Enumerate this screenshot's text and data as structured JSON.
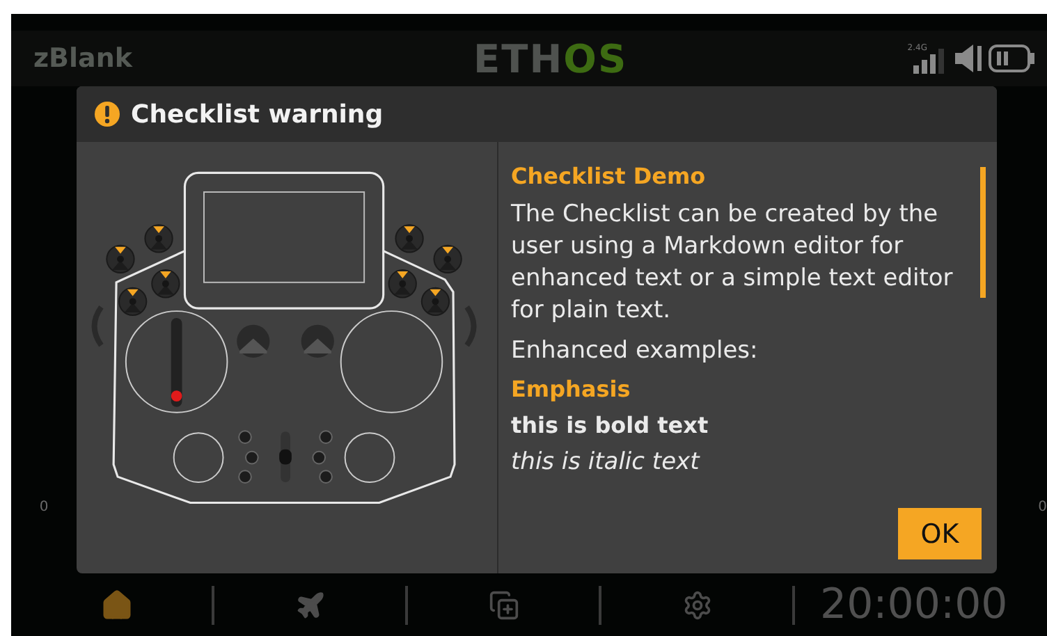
{
  "topbar": {
    "model_name": "zBlank",
    "logo": {
      "part_1": "ETH",
      "part_2": "OS"
    },
    "radio_band": "2.4G"
  },
  "background_readings": [
    "0",
    "0"
  ],
  "dialog": {
    "title": "Checklist warning",
    "content": [
      {
        "kind": "heading",
        "text": "Checklist Demo"
      },
      {
        "kind": "paragraph",
        "text": "The Checklist can be created by the user using a Markdown editor for enhanced text or a simple text editor for plain text."
      },
      {
        "kind": "paragraph",
        "text": "Enhanced examples:"
      },
      {
        "kind": "heading",
        "text": "Emphasis"
      },
      {
        "kind": "bold",
        "text": "this is bold text"
      },
      {
        "kind": "italic",
        "text": "this is italic text"
      }
    ],
    "button": "OK"
  },
  "navbar": {
    "items": [
      {
        "kind": "home",
        "selected": true
      },
      {
        "kind": "plane",
        "selected": false
      },
      {
        "kind": "copy",
        "selected": false
      },
      {
        "kind": "gear",
        "selected": false
      }
    ],
    "timer": "20:00:00"
  }
}
